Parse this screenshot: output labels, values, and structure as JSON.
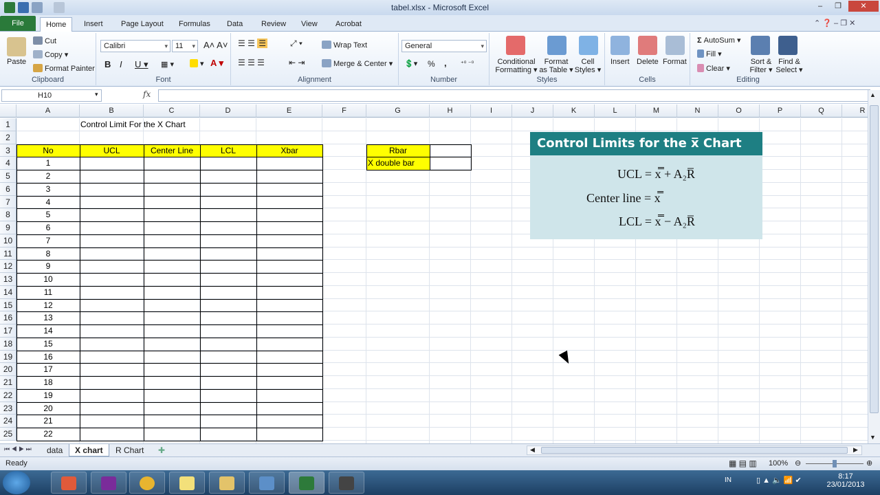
{
  "window": {
    "title": "tabel.xlsx - Microsoft Excel"
  },
  "tabs": [
    "File",
    "Home",
    "Insert",
    "Page Layout",
    "Formulas",
    "Data",
    "Review",
    "View",
    "Acrobat"
  ],
  "ribbon": {
    "clipboard": {
      "paste": "Paste",
      "cut": "Cut",
      "copy": "Copy",
      "format_painter": "Format Painter",
      "label": "Clipboard"
    },
    "font": {
      "name": "Calibri",
      "size": "11",
      "label": "Font"
    },
    "alignment": {
      "wrap": "Wrap Text",
      "merge": "Merge & Center",
      "label": "Alignment"
    },
    "number": {
      "format": "General",
      "percent": "%",
      "comma": ",",
      "label": "Number"
    },
    "styles": {
      "conditional": "Conditional",
      "conditional2": "Formatting",
      "format_table": "Format",
      "format_table2": "as Table",
      "cell_styles": "Cell",
      "cell_styles2": "Styles",
      "label": "Styles"
    },
    "cells": {
      "insert": "Insert",
      "delete": "Delete",
      "format": "Format",
      "label": "Cells"
    },
    "editing": {
      "autosum": "AutoSum",
      "fill": "Fill",
      "clear": "Clear",
      "sort": "Sort &",
      "sort2": "Filter",
      "find": "Find &",
      "find2": "Select",
      "label": "Editing"
    }
  },
  "formula_bar": {
    "name_box": "H10",
    "fx": "fx"
  },
  "columns": [
    "A",
    "B",
    "C",
    "D",
    "E",
    "F",
    "G",
    "H",
    "I",
    "J",
    "K",
    "L",
    "M",
    "N",
    "O",
    "P",
    "Q",
    "R"
  ],
  "rows": [
    "1",
    "2",
    "3",
    "4",
    "5",
    "6",
    "7",
    "8",
    "9",
    "10",
    "11",
    "12",
    "13",
    "14",
    "15",
    "16",
    "17",
    "18",
    "19",
    "20",
    "21",
    "22",
    "23",
    "24",
    "25"
  ],
  "sheet": {
    "title": "Control Limit For the X Chart",
    "headers": [
      "No",
      "UCL",
      "Center Line",
      "LCL",
      "Xbar"
    ],
    "numbers": [
      "1",
      "2",
      "3",
      "4",
      "5",
      "6",
      "7",
      "8",
      "9",
      "10",
      "11",
      "12",
      "13",
      "14",
      "15",
      "16",
      "17",
      "18",
      "19",
      "20",
      "21",
      "22"
    ],
    "rbar_label": "Rbar",
    "xdbar_label": "X double bar"
  },
  "image": {
    "title": "Control Limits for the x̅ Chart",
    "eq1": "UCL = x̿ + A₂R̅",
    "eq2": "Center line = x̿",
    "eq3": "LCL = x̿ − A₂R̅"
  },
  "sheet_tabs": [
    "data",
    "X chart",
    "R Chart"
  ],
  "status": {
    "ready": "Ready",
    "zoom": "100%"
  },
  "taskbar": {
    "lang": "IN",
    "time": "8:17",
    "date": "23/01/2013"
  }
}
